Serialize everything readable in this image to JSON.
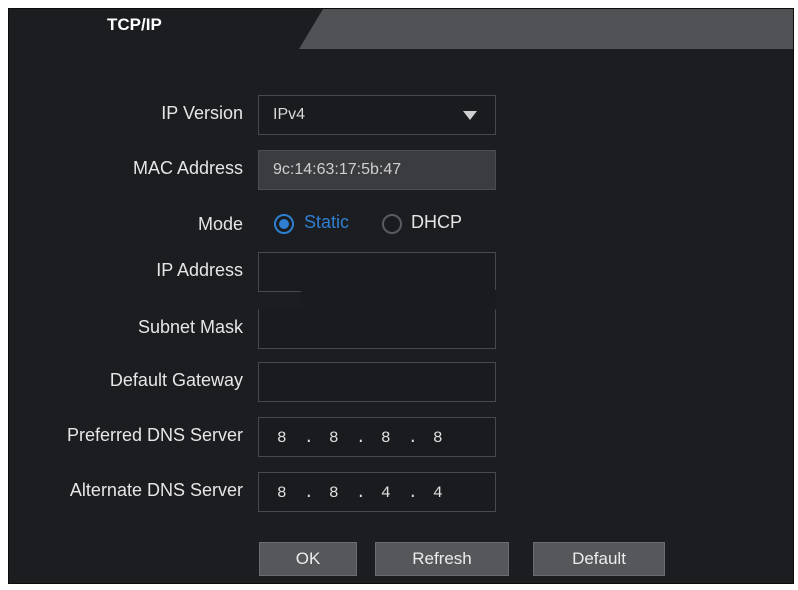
{
  "tab": {
    "title": "TCP/IP"
  },
  "form": {
    "ip_version": {
      "label": "IP Version",
      "value": "IPv4"
    },
    "mac_address": {
      "label": "MAC Address",
      "value": "9c:14:63:17:5b:47"
    },
    "mode": {
      "label": "Mode",
      "options": [
        "Static",
        "DHCP"
      ],
      "selected": "Static"
    },
    "ip_address": {
      "label": "IP Address",
      "value": ""
    },
    "subnet_mask": {
      "label": "Subnet Mask",
      "value": ""
    },
    "default_gateway": {
      "label": "Default Gateway",
      "value": ""
    },
    "preferred_dns": {
      "label": "Preferred DNS Server",
      "octets": [
        "8",
        "8",
        "8",
        "8"
      ]
    },
    "alternate_dns": {
      "label": "Alternate DNS Server",
      "octets": [
        "8",
        "8",
        "4",
        "4"
      ]
    }
  },
  "buttons": {
    "ok": "OK",
    "refresh": "Refresh",
    "default": "Default"
  },
  "colors": {
    "accent": "#2f7fd0",
    "background": "#1c1d21",
    "button": "#55575b"
  }
}
